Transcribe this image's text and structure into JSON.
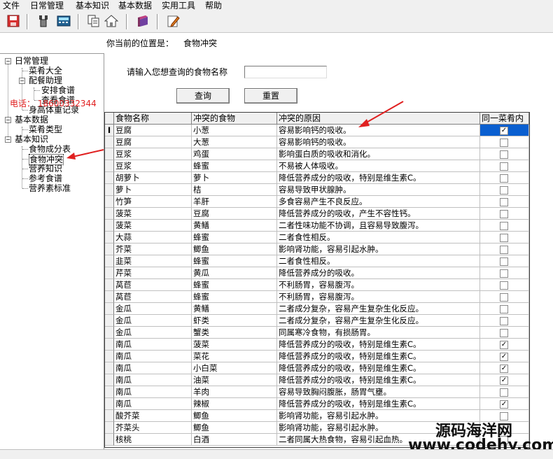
{
  "menu": [
    "文件",
    "日常管理",
    "基本知识",
    "基本数据",
    "实用工具",
    "帮助"
  ],
  "toolbar": {
    "buttons": [
      "save-icon",
      "tool-icon",
      "calculator-icon",
      "copy-icon",
      "home-icon",
      "book-icon",
      "edit-icon"
    ]
  },
  "location": {
    "label": "你当前的位置是：",
    "value": "食物冲突"
  },
  "tree": {
    "root1": "日常管理",
    "item_cai": "菜肴大全",
    "item_peican": "配餐助理",
    "item_anpai": "安排食谱",
    "item_chakan": "查看食谱",
    "item_shengao": "身高体重记录",
    "root2": "基本数据",
    "item_caiyao": "菜肴类型",
    "root3": "基本知识",
    "item_chengfen": "食物成分表",
    "item_chongtu": "食物冲突",
    "item_yingyang": "营养知识",
    "item_cankao": "参考食谱",
    "item_biaozhun": "营养素标准"
  },
  "phone": "电话：  18600332344",
  "search": {
    "label": "请输入您想查询的食物名称",
    "value": "",
    "query_label": "查询",
    "reset_label": "重置"
  },
  "table": {
    "columns": [
      "食物名称",
      "冲突的食物",
      "冲突的原因",
      "同一菜肴内"
    ],
    "current_row_marker": "I",
    "rows": [
      {
        "food": "豆腐",
        "conflict": "小葱",
        "reason": "容易影响钙的吸收。",
        "same": true
      },
      {
        "food": "豆腐",
        "conflict": "大葱",
        "reason": "容易影响钙的吸收。",
        "same": false
      },
      {
        "food": "豆浆",
        "conflict": "鸡蛋",
        "reason": "影响蛋白质的吸收和消化。",
        "same": false
      },
      {
        "food": "豆浆",
        "conflict": "蜂蜜",
        "reason": "不易被人体吸收。",
        "same": false
      },
      {
        "food": "胡萝卜",
        "conflict": "萝卜",
        "reason": "降低营养成分的吸收，特别是维生素C。",
        "same": false
      },
      {
        "food": "萝卜",
        "conflict": "桔",
        "reason": "容易导致甲状腺肿。",
        "same": false
      },
      {
        "food": "竹笋",
        "conflict": "羊肝",
        "reason": "多食容易产生不良反应。",
        "same": false
      },
      {
        "food": "菠菜",
        "conflict": "豆腐",
        "reason": "降低营养成分的吸收，产生不容性钙。",
        "same": false
      },
      {
        "food": "菠菜",
        "conflict": "黄鳝",
        "reason": "二者性味功能不协调，且容易导致腹泻。",
        "same": false
      },
      {
        "food": "大蒜",
        "conflict": "蜂蜜",
        "reason": "二者食性相反。",
        "same": false
      },
      {
        "food": "芥菜",
        "conflict": "鲫鱼",
        "reason": "影响肾功能，容易引起水肿。",
        "same": false
      },
      {
        "food": "韭菜",
        "conflict": "蜂蜜",
        "reason": "二者食性相反。",
        "same": false
      },
      {
        "food": "芹菜",
        "conflict": "黄瓜",
        "reason": "降低营养成分的吸收。",
        "same": false
      },
      {
        "food": "莴苣",
        "conflict": "蜂蜜",
        "reason": "不利肠胃，容易腹泻。",
        "same": false
      },
      {
        "food": "莴苣",
        "conflict": "蜂蜜",
        "reason": "不利肠胃，容易腹泻。",
        "same": false
      },
      {
        "food": "金瓜",
        "conflict": "黄鳝",
        "reason": "二者成分复杂，容易产生复杂生化反应。",
        "same": false
      },
      {
        "food": "金瓜",
        "conflict": "虾类",
        "reason": "二者成分复杂，容易产生复杂生化反应。",
        "same": false
      },
      {
        "food": "金瓜",
        "conflict": "蟹类",
        "reason": "同属寒冷食物，有损肠胃。",
        "same": false
      },
      {
        "food": "南瓜",
        "conflict": "菠菜",
        "reason": "降低营养成分的吸收，特别是维生素C。",
        "same": true
      },
      {
        "food": "南瓜",
        "conflict": "菜花",
        "reason": "降低营养成分的吸收，特别是维生素C。",
        "same": true
      },
      {
        "food": "南瓜",
        "conflict": "小白菜",
        "reason": "降低营养成分的吸收，特别是维生素C。",
        "same": true
      },
      {
        "food": "南瓜",
        "conflict": "油菜",
        "reason": "降低营养成分的吸收，特别是维生素C。",
        "same": true
      },
      {
        "food": "南瓜",
        "conflict": "羊肉",
        "reason": "容易导致胸闷腹胀，肠胃气壅。",
        "same": false
      },
      {
        "food": "南瓜",
        "conflict": "辣椒",
        "reason": "降低营养成分的吸收，特别是维生素C。",
        "same": true
      },
      {
        "food": "酸芥菜",
        "conflict": "鲫鱼",
        "reason": "影响肾功能，容易引起水肿。",
        "same": false
      },
      {
        "food": "芥菜头",
        "conflict": "鲫鱼",
        "reason": "影响肾功能，容易引起水肿。",
        "same": false
      },
      {
        "food": "核桃",
        "conflict": "白酒",
        "reason": "二者同属大热食物，容易引起血热。",
        "same": false
      }
    ]
  },
  "watermark": {
    "line1": "源码海洋网",
    "line2": "www.codehy.com"
  },
  "colors": {
    "selection": "#0a5fd0",
    "annotation_arrow": "#e02020"
  }
}
